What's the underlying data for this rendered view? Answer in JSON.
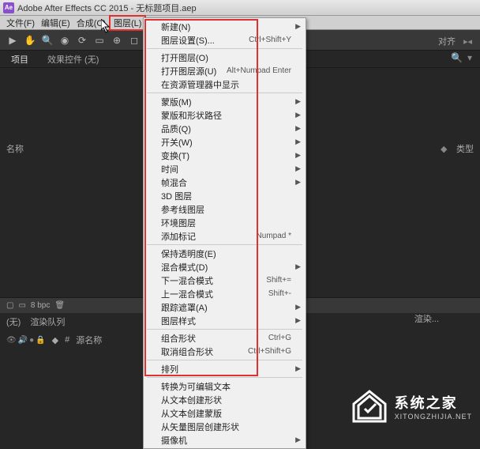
{
  "titlebar": {
    "app_icon": "Ae",
    "title": "Adobe After Effects CC 2015 - 无标题项目.aep"
  },
  "menubar": {
    "file": "文件(F)",
    "edit": "编辑(E)",
    "composition": "合成(C)",
    "layer": "图层(L)"
  },
  "tabs": {
    "project": "项目",
    "effect_controls": "效果控件 (无)"
  },
  "side": {
    "name": "名称",
    "type": "类型"
  },
  "right": {
    "align": "对齐",
    "render": "渲染..."
  },
  "footer": {
    "bpc": "8 bpc"
  },
  "lower": {
    "none": "(无)",
    "render_queue": "渲染队列",
    "source_name": "源名称"
  },
  "menu": {
    "new": "新建(N)",
    "layer_settings": "图层设置(S)...",
    "layer_settings_key": "Ctrl+Shift+Y",
    "open_layer": "打开图层(O)",
    "open_layer_source": "打开图层源(U)",
    "open_layer_source_key": "Alt+Numpad Enter",
    "reveal_in_browser": "在资源管理器中显示",
    "mask": "蒙版(M)",
    "mask_shape": "蒙版和形状路径",
    "quality": "品质(Q)",
    "switches": "开关(W)",
    "transform": "变换(T)",
    "time": "时间",
    "frame_blending": "帧混合",
    "3d_layer": "3D 图层",
    "guide_layer": "参考线图层",
    "environment_layer": "环境图层",
    "add_marker": "添加标记",
    "add_marker_key": "Numpad *",
    "preserve_transparency": "保持透明度(E)",
    "blending_mode": "混合模式(D)",
    "next_blend": "下一混合模式",
    "next_blend_key": "Shift+=",
    "prev_blend": "上一混合模式",
    "prev_blend_key": "Shift+-",
    "track_matte": "跟踪遮罩(A)",
    "layer_styles": "图层样式",
    "group_shapes": "组合形状",
    "group_shapes_key": "Ctrl+G",
    "ungroup_shapes": "取消组合形状",
    "ungroup_shapes_key": "Ctrl+Shift+G",
    "arrange": "排列",
    "convert_to_editable": "转换为可编辑文本",
    "create_shapes_from_text": "从文本创建形状",
    "create_masks_from_text": "从文本创建蒙版",
    "create_shapes_from_vector": "从矢量图层创建形状",
    "camera": "摄像机"
  },
  "watermark": {
    "main": "系统之家",
    "sub": "XITONGZHIJIA.NET"
  }
}
